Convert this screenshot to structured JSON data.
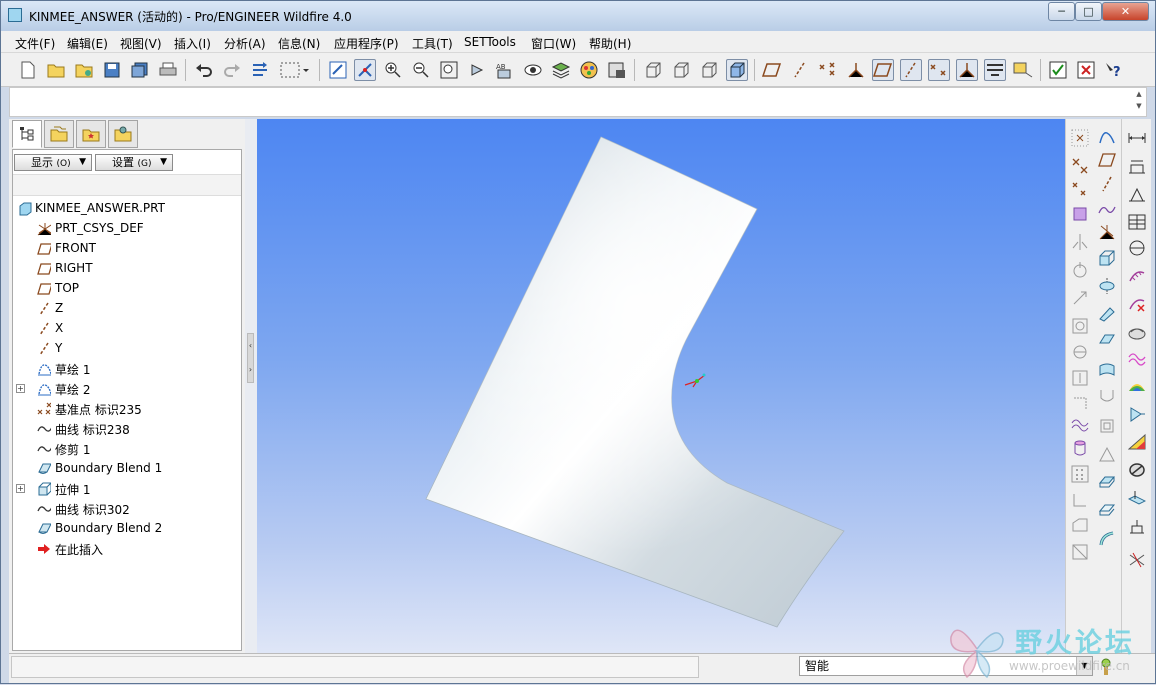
{
  "window": {
    "title": "KINMEE_ANSWER (活动的) - Pro/ENGINEER Wildfire 4.0",
    "min_label": "─",
    "max_label": "□",
    "close_label": "✕"
  },
  "menu": [
    "文件(F)",
    "编辑(E)",
    "视图(V)",
    "插入(I)",
    "分析(A)",
    "信息(N)",
    "应用程序(P)",
    "工具(T)",
    "SETTools",
    "窗口(W)",
    "帮助(H)"
  ],
  "model_tree": {
    "show_label": "显示",
    "show_shortcut": "(O)",
    "settings_label": "设置",
    "settings_shortcut": "(G)",
    "items": [
      {
        "label": "KINMEE_ANSWER.PRT",
        "icon": "part-icon"
      },
      {
        "label": "PRT_CSYS_DEF",
        "icon": "csys-icon"
      },
      {
        "label": "FRONT",
        "icon": "datum-plane-icon"
      },
      {
        "label": "RIGHT",
        "icon": "datum-plane-icon"
      },
      {
        "label": "TOP",
        "icon": "datum-plane-icon"
      },
      {
        "label": "Z",
        "icon": "datum-axis-icon"
      },
      {
        "label": "X",
        "icon": "datum-axis-icon"
      },
      {
        "label": "Y",
        "icon": "datum-axis-icon"
      },
      {
        "label": "草绘 1",
        "icon": "sketch-icon"
      },
      {
        "label": "草绘 2",
        "icon": "sketch-icon"
      },
      {
        "label": "基准点 标识235",
        "icon": "datum-point-icon"
      },
      {
        "label": "曲线 标识238",
        "icon": "curve-icon"
      },
      {
        "label": "修剪 1",
        "icon": "curve-icon"
      },
      {
        "label": "Boundary Blend 1",
        "icon": "boundary-blend-icon"
      },
      {
        "label": "拉伸 1",
        "icon": "extrude-icon"
      },
      {
        "label": "曲线 标识302",
        "icon": "curve-icon"
      },
      {
        "label": "Boundary Blend 2",
        "icon": "boundary-blend-icon"
      },
      {
        "label": "在此插入",
        "icon": "insert-here-arrow-icon"
      }
    ]
  },
  "status": {
    "filter_value": "智能"
  },
  "watermark": {
    "text": "野火论坛",
    "url": "www.proewildfire.cn"
  },
  "colors": {
    "viewport_top": "#4d86f2",
    "viewport_bottom": "#dfe6f7",
    "surface": "#c9d3dc",
    "datum_plane": "#8b4a1f",
    "insert_arrow": "#e02020"
  }
}
